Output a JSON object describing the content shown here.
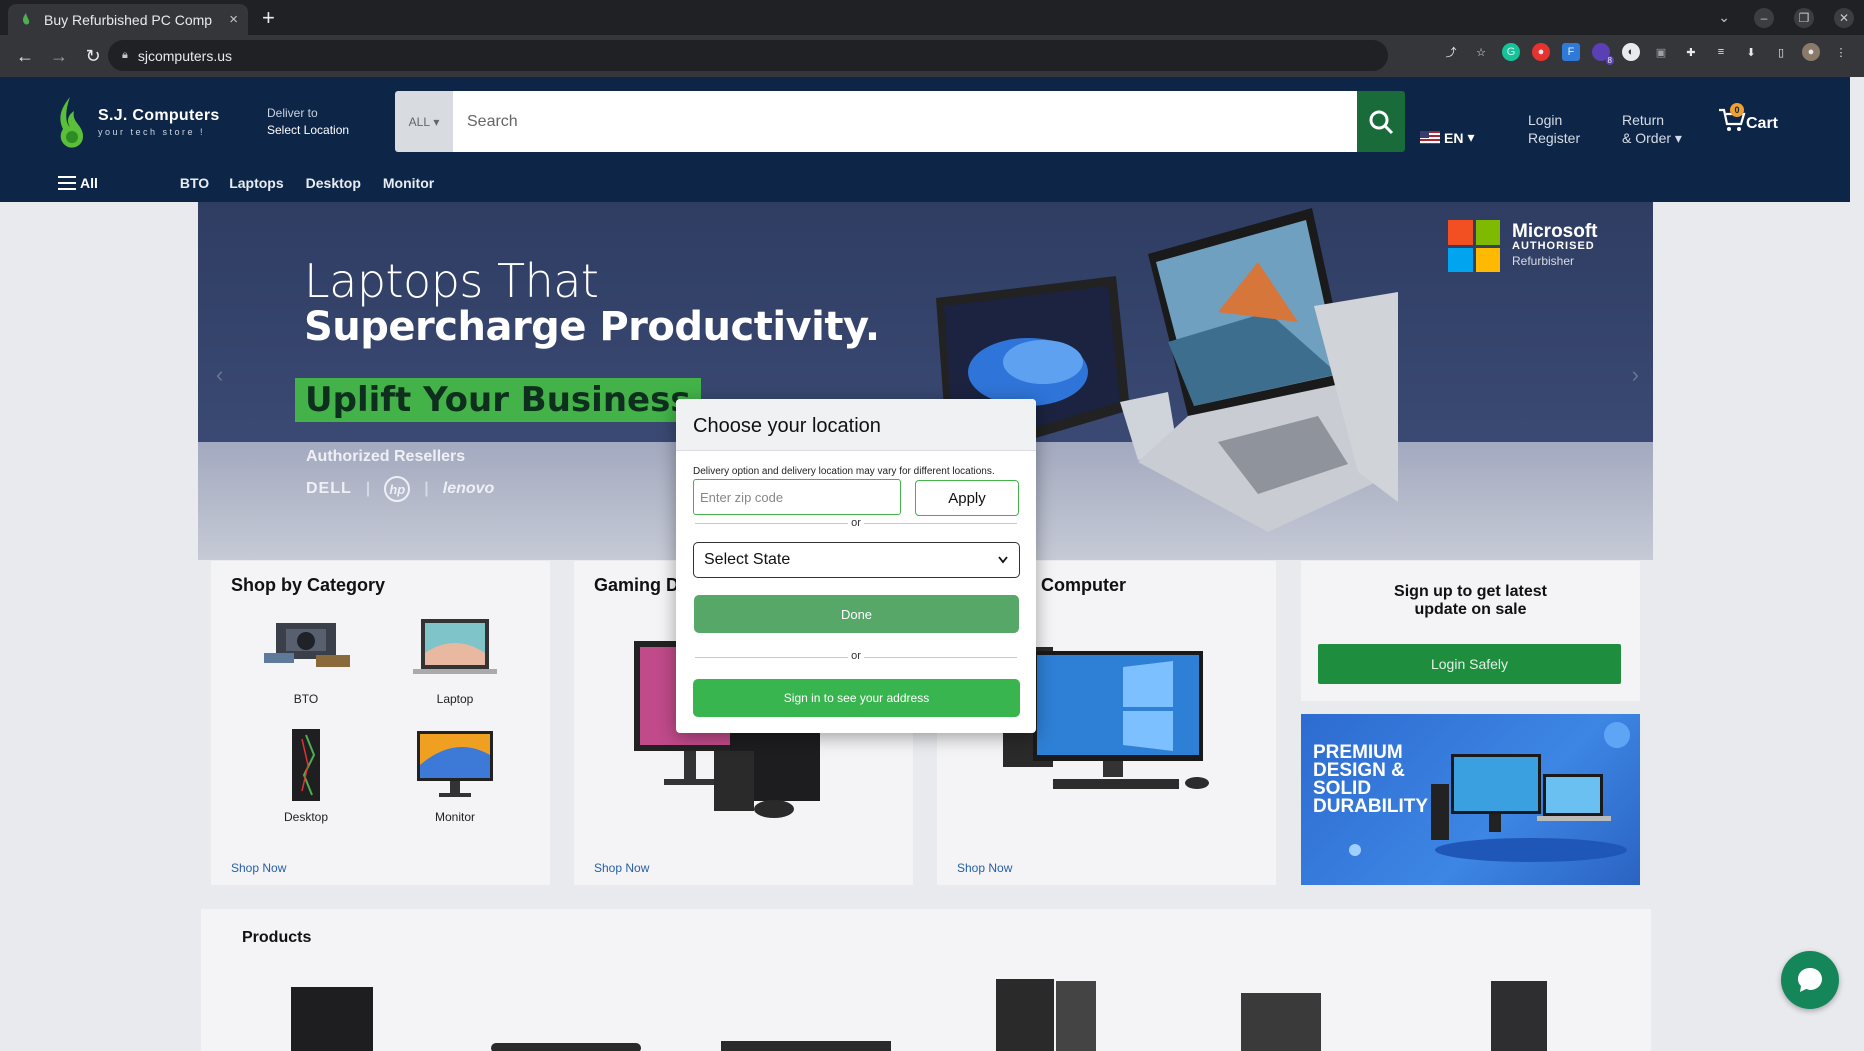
{
  "browser": {
    "tab_title": "Buy Refurbished PC Comp",
    "tab_close": "×",
    "new_tab": "+",
    "url": "sjcomputers.us",
    "extension_badge": "8"
  },
  "header": {
    "logo_name": "S.J. Computers",
    "logo_tagline": "your tech store !",
    "deliver_label": "Deliver to",
    "deliver_location": "Select Location",
    "search_category": "ALL",
    "search_placeholder": "Search",
    "language": "EN",
    "login": "Login",
    "register": "Register",
    "returns": "Return",
    "orders": "& Order",
    "cart_count": "0",
    "cart_label": "Cart"
  },
  "subnav": {
    "all": "All",
    "links": [
      "BTO",
      "Laptops",
      "Desktop",
      "Monitor"
    ]
  },
  "hero": {
    "line1": "Laptops That",
    "line2": "Supercharge Productivity.",
    "line3": "Uplift Your Business",
    "resellers": "Authorized Resellers",
    "brands": [
      "DELL",
      "hp",
      "lenovo"
    ],
    "ms_name": "Microsoft",
    "ms_authorised": "AUTHORISED",
    "ms_refurbisher": "Refurbisher"
  },
  "cards": {
    "category": {
      "title": "Shop by Category",
      "items": [
        "BTO",
        "Laptop",
        "Desktop",
        "Monitor"
      ],
      "link": "Shop Now"
    },
    "gaming": {
      "title": "Gaming D",
      "link": "Shop Now"
    },
    "computer": {
      "title": "Computer",
      "link": "Shop Now"
    },
    "signup": {
      "text": "Sign up to get latest update on sale",
      "button": "Login Safely"
    },
    "promo": {
      "text": "PREMIUM DESIGN & SOLID DURABILITY"
    }
  },
  "products": {
    "title": "Products"
  },
  "modal": {
    "title": "Choose your location",
    "note": "Delivery option and delivery location may vary for different locations.",
    "zip_placeholder": "Enter zip code",
    "apply": "Apply",
    "or": "or",
    "state_select": "Select State",
    "done": "Done",
    "signin": "Sign in to see your address"
  },
  "colors": {
    "header_bg": "#0d2547",
    "accent_green": "#39b54f",
    "done_green": "#56a768",
    "search_btn": "#1a6b3a"
  }
}
